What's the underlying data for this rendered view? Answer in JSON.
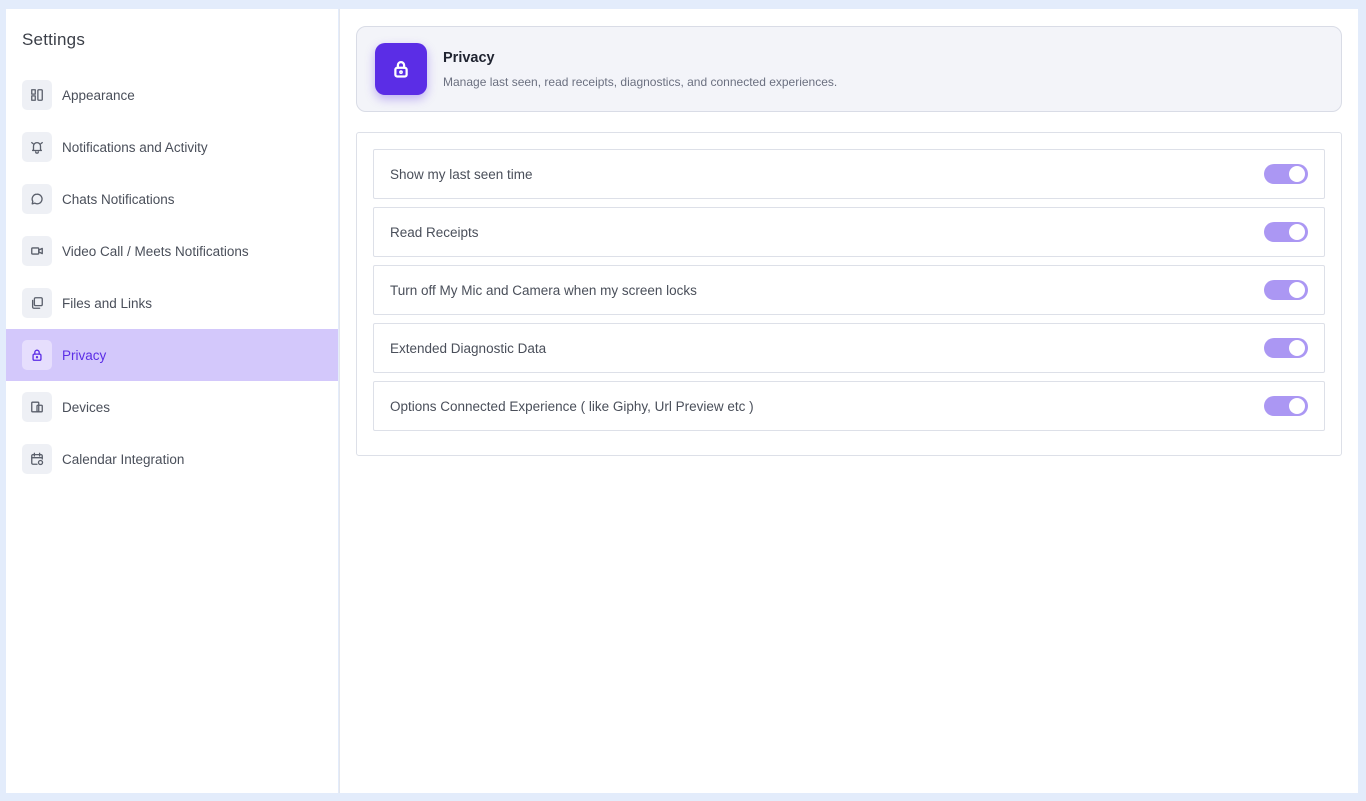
{
  "sidebar": {
    "title": "Settings",
    "items": [
      {
        "label": "Appearance",
        "icon": "layout-icon"
      },
      {
        "label": "Notifications and Activity",
        "icon": "bell-icon"
      },
      {
        "label": "Chats Notifications",
        "icon": "chat-bubble-icon"
      },
      {
        "label": "Video Call / Meets Notifications",
        "icon": "video-camera-icon"
      },
      {
        "label": "Files and Links",
        "icon": "files-icon"
      },
      {
        "label": "Privacy",
        "icon": "lock-icon",
        "active": true
      },
      {
        "label": "Devices",
        "icon": "devices-icon"
      },
      {
        "label": "Calendar Integration",
        "icon": "calendar-icon"
      }
    ]
  },
  "header": {
    "title": "Privacy",
    "subtitle": "Manage last seen, read receipts, diagnostics, and connected experiences.",
    "icon": "lock-icon"
  },
  "settings": [
    {
      "label": "Show my last seen time",
      "enabled": true
    },
    {
      "label": "Read Receipts",
      "enabled": true
    },
    {
      "label": "Turn off My Mic and Camera when my screen locks",
      "enabled": true
    },
    {
      "label": "Extended Diagnostic Data",
      "enabled": true
    },
    {
      "label": "Options Connected Experience ( like Giphy, Url Preview etc )",
      "enabled": true
    }
  ],
  "colors": {
    "accent": "#5b2de6",
    "active_bg": "#d3c8fb",
    "toggle_on": "#ab97f3",
    "page_bg": "#e3ecfb"
  }
}
